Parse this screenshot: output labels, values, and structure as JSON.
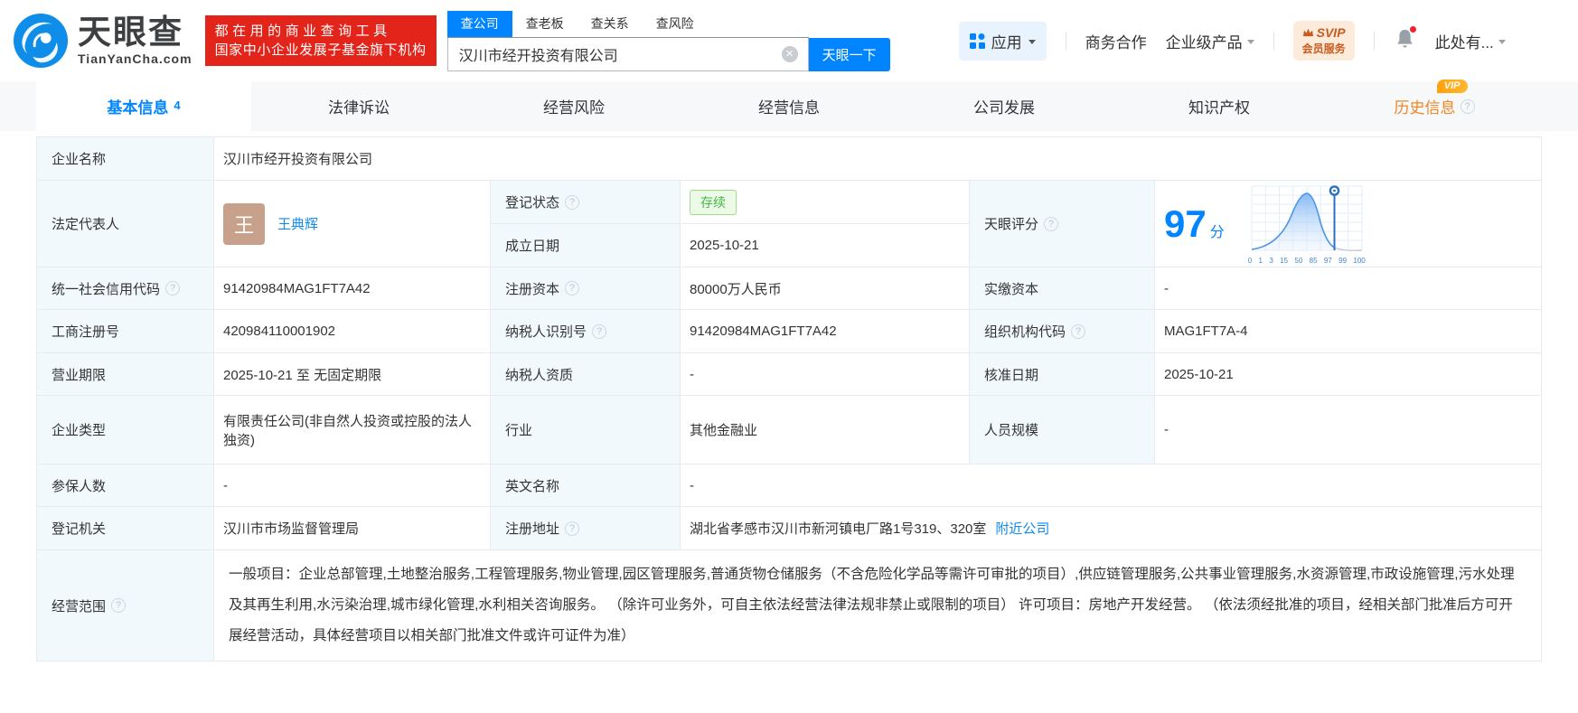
{
  "brand": {
    "logo_title": "天眼查",
    "logo_domain": "TianYanCha.com",
    "slogan_line1": "都在用的商业查询工具",
    "slogan_line2": "国家中小企业发展子基金旗下机构"
  },
  "search": {
    "tabs": [
      {
        "label": "查公司"
      },
      {
        "label": "查老板"
      },
      {
        "label": "查关系"
      },
      {
        "label": "查风险"
      }
    ],
    "query": "汉川市经开投资有限公司",
    "button_label": "天眼一下"
  },
  "header_nav": {
    "apps": "应用",
    "biz_coop": "商务合作",
    "enterprise_products": "企业级产品",
    "svip_line1": "SVIP",
    "svip_line2": "会员服务",
    "user": "此处有..."
  },
  "page_tabs": [
    {
      "label": "基本信息",
      "count": "4"
    },
    {
      "label": "法律诉讼"
    },
    {
      "label": "经营风险"
    },
    {
      "label": "经营信息"
    },
    {
      "label": "公司发展"
    },
    {
      "label": "知识产权"
    },
    {
      "label": "历史信息",
      "vip": "VIP"
    }
  ],
  "table": {
    "company_name": {
      "label": "企业名称",
      "value": "汉川市经开投资有限公司"
    },
    "legal_rep": {
      "label": "法定代表人",
      "avatar_char": "王",
      "name": "王典辉"
    },
    "reg_status": {
      "label": "登记状态",
      "value": "存续"
    },
    "est_date": {
      "label": "成立日期",
      "value": "2025-10-21"
    },
    "score": {
      "label": "天眼评分",
      "value": "97",
      "unit": "分",
      "ticks": [
        "0",
        "1",
        "3",
        "15",
        "50",
        "85",
        "97",
        "99",
        "100"
      ]
    },
    "credit_code": {
      "label": "统一社会信用代码",
      "value": "91420984MAG1FT7A42"
    },
    "reg_capital": {
      "label": "注册资本",
      "value": "80000万人民币"
    },
    "paid_capital": {
      "label": "实缴资本",
      "value": "-"
    },
    "reg_number": {
      "label": "工商注册号",
      "value": "420984110001902"
    },
    "taxpayer_id": {
      "label": "纳税人识别号",
      "value": "91420984MAG1FT7A42"
    },
    "org_code": {
      "label": "组织机构代码",
      "value": "MAG1FT7A-4"
    },
    "business_term": {
      "label": "营业期限",
      "value": "2025-10-21 至 无固定期限"
    },
    "taxpayer_qual": {
      "label": "纳税人资质",
      "value": "-"
    },
    "approval_date": {
      "label": "核准日期",
      "value": "2025-10-21"
    },
    "company_type": {
      "label": "企业类型",
      "value": "有限责任公司(非自然人投资或控股的法人独资)"
    },
    "industry": {
      "label": "行业",
      "value": "其他金融业"
    },
    "staff_size": {
      "label": "人员规模",
      "value": "-"
    },
    "insured_count": {
      "label": "参保人数",
      "value": "-"
    },
    "english_name": {
      "label": "英文名称",
      "value": "-"
    },
    "reg_authority": {
      "label": "登记机关",
      "value": "汉川市市场监督管理局"
    },
    "reg_address": {
      "label": "注册地址",
      "value": "湖北省孝感市汉川市新河镇电厂路1号319、320室",
      "link": "附近公司"
    },
    "business_scope": {
      "label": "经营范围",
      "value": "一般项目：企业总部管理,土地整治服务,工程管理服务,物业管理,园区管理服务,普通货物仓储服务（不含危险化学品等需许可审批的项目）,供应链管理服务,公共事业管理服务,水资源管理,市政设施管理,污水处理及其再生利用,水污染治理,城市绿化管理,水利相关咨询服务。 （除许可业务外，可自主依法经营法律法规非禁止或限制的项目） 许可项目：房地产开发经营。 （依法须经批准的项目，经相关部门批准后方可开展经营活动，具体经营项目以相关部门批准文件或许可证件为准）"
    }
  },
  "colors": {
    "accent_blue": "#0084ff",
    "link_blue": "#128bed",
    "banner_red": "#e3241b",
    "status_green": "#45b84a",
    "vip_orange": "#ffa10a",
    "svip_text": "#c75b20"
  }
}
